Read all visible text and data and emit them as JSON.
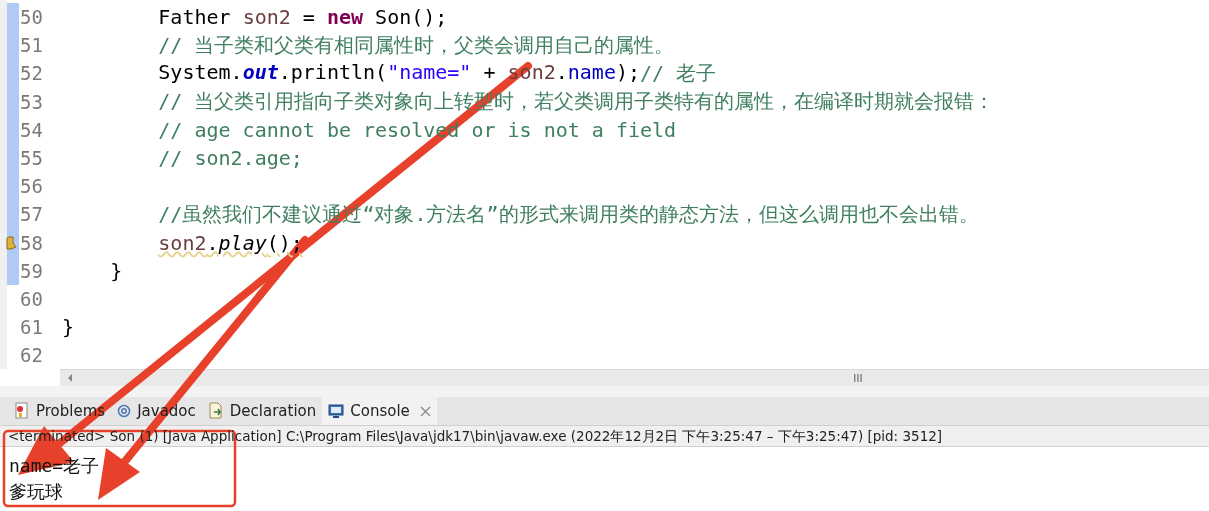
{
  "editor": {
    "lines": [
      {
        "number": "50",
        "changed": true,
        "warning": false,
        "tokens": [
          {
            "text": "        Father ",
            "kind": "plain"
          },
          {
            "text": "son2",
            "kind": "var"
          },
          {
            "text": " = ",
            "kind": "plain"
          },
          {
            "text": "new",
            "kind": "keyword"
          },
          {
            "text": " Son();",
            "kind": "plain"
          }
        ]
      },
      {
        "number": "51",
        "changed": true,
        "warning": false,
        "tokens": [
          {
            "text": "        // 当子类和父类有相同属性时，父类会调用自己的属性。",
            "kind": "comment"
          }
        ]
      },
      {
        "number": "52",
        "changed": true,
        "warning": false,
        "tokens": [
          {
            "text": "        System.",
            "kind": "plain"
          },
          {
            "text": "out",
            "kind": "static"
          },
          {
            "text": ".println(",
            "kind": "plain"
          },
          {
            "text": "\"name=\"",
            "kind": "string"
          },
          {
            "text": " + ",
            "kind": "plain"
          },
          {
            "text": "son2",
            "kind": "var"
          },
          {
            "text": ".",
            "kind": "plain"
          },
          {
            "text": "name",
            "kind": "field"
          },
          {
            "text": ");",
            "kind": "plain"
          },
          {
            "text": "// 老子",
            "kind": "comment"
          }
        ]
      },
      {
        "number": "53",
        "changed": true,
        "warning": false,
        "tokens": [
          {
            "text": "        // 当父类引用指向子类对象向上转型时，若父类调用子类特有的属性，在编译时期就会报错：",
            "kind": "comment"
          }
        ]
      },
      {
        "number": "54",
        "changed": true,
        "warning": false,
        "tokens": [
          {
            "text": "        // age cannot be resolved or is not a field",
            "kind": "comment"
          }
        ]
      },
      {
        "number": "55",
        "changed": true,
        "warning": false,
        "tokens": [
          {
            "text": "        // son2.age;",
            "kind": "comment"
          }
        ]
      },
      {
        "number": "56",
        "changed": true,
        "warning": false
      },
      {
        "number": "57",
        "changed": true,
        "warning": false,
        "tokens": [
          {
            "text": "        //虽然我们不建议通过“对象.方法名”的形式来调用类的静态方法，但这么调用也不会出错。",
            "kind": "comment"
          }
        ]
      },
      {
        "number": "58",
        "changed": true,
        "warning": true,
        "tokens": [
          {
            "text": "        son2",
            "kind": "var"
          },
          {
            "text": ".",
            "kind": "plain"
          },
          {
            "text": "play",
            "kind": "method"
          },
          {
            "text": "();",
            "kind": "plain"
          }
        ]
      },
      {
        "number": "59",
        "changed": true,
        "warning": false,
        "tokens": [
          {
            "text": "    }",
            "kind": "plain"
          }
        ]
      },
      {
        "number": "60",
        "changed": false,
        "warning": false
      },
      {
        "number": "61",
        "changed": false,
        "warning": false,
        "tokens": [
          {
            "text": "}",
            "kind": "plain"
          }
        ]
      },
      {
        "number": "62",
        "changed": false,
        "warning": false
      }
    ]
  },
  "tabs": [
    {
      "label": "Problems",
      "kind": "problems",
      "selected": false
    },
    {
      "label": "Javadoc",
      "kind": "javadoc",
      "selected": false
    },
    {
      "label": "Declaration",
      "kind": "declaration",
      "selected": false
    },
    {
      "label": "Console",
      "kind": "console",
      "selected": true
    }
  ],
  "console": {
    "status": "<terminated> Son (1) [Java Application] C:\\Program Files\\Java\\jdk17\\bin\\javaw.exe  (2022年12月2日 下午3:25:47 – 下午3:25:47) [pid: 3512]",
    "output": [
      "name=老子",
      "爹玩球"
    ]
  }
}
